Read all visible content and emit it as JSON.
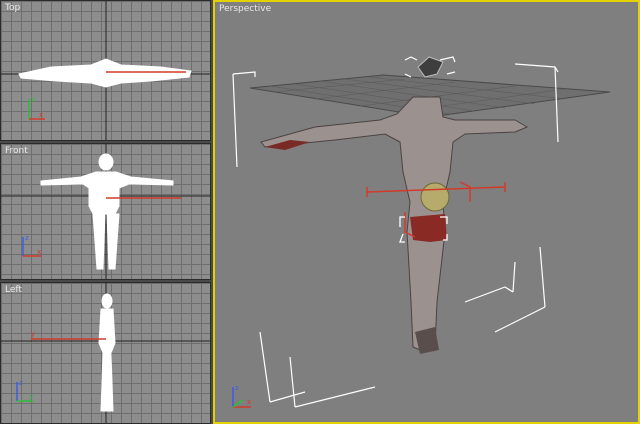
{
  "viewports": {
    "top": {
      "label": "Top"
    },
    "front": {
      "label": "Front"
    },
    "left": {
      "label": "Left"
    },
    "perspective": {
      "label": "Perspective"
    }
  },
  "axes": {
    "x": "x",
    "y": "y",
    "z": "z"
  },
  "colors": {
    "active_border": "#e4d200",
    "gizmo_red": "#d23a2a",
    "axis_green": "#2bbf3a",
    "axis_blue": "#3a5fe0"
  }
}
